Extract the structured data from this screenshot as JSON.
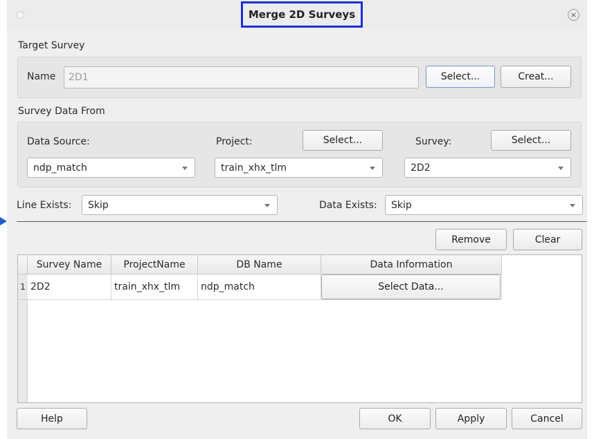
{
  "window": {
    "title": "Merge 2D Surveys",
    "close_glyph": "×"
  },
  "target_survey": {
    "section_label": "Target Survey",
    "name_label": "Name",
    "name_value": "2D1",
    "select_label": "Select...",
    "create_label": "Creat..."
  },
  "survey_data_from": {
    "section_label": "Survey Data From",
    "data_source_label": "Data Source:",
    "data_source_value": "ndp_match",
    "project_label": "Project:",
    "project_select_label": "Select...",
    "project_value": "train_xhx_tlm",
    "survey_label": "Survey:",
    "survey_select_label": "Select...",
    "survey_value": "2D2"
  },
  "options": {
    "line_exists_label": "Line Exists:",
    "line_exists_value": "Skip",
    "data_exists_label": "Data Exists:",
    "data_exists_value": "Skip"
  },
  "table_actions": {
    "remove_label": "Remove",
    "clear_label": "Clear"
  },
  "table": {
    "columns": [
      "Survey Name",
      "ProjectName",
      "DB Name",
      "Data Information"
    ],
    "rows": [
      {
        "num": "1",
        "survey_name": "2D2",
        "project_name": "train_xhx_tlm",
        "db_name": "ndp_match",
        "data_info_button": "Select Data..."
      }
    ]
  },
  "footer": {
    "help_label": "Help",
    "ok_label": "OK",
    "apply_label": "Apply",
    "cancel_label": "Cancel"
  },
  "colors": {
    "title_highlight": "#1a2fd6",
    "pointer_arrow": "#1d5fcc"
  }
}
